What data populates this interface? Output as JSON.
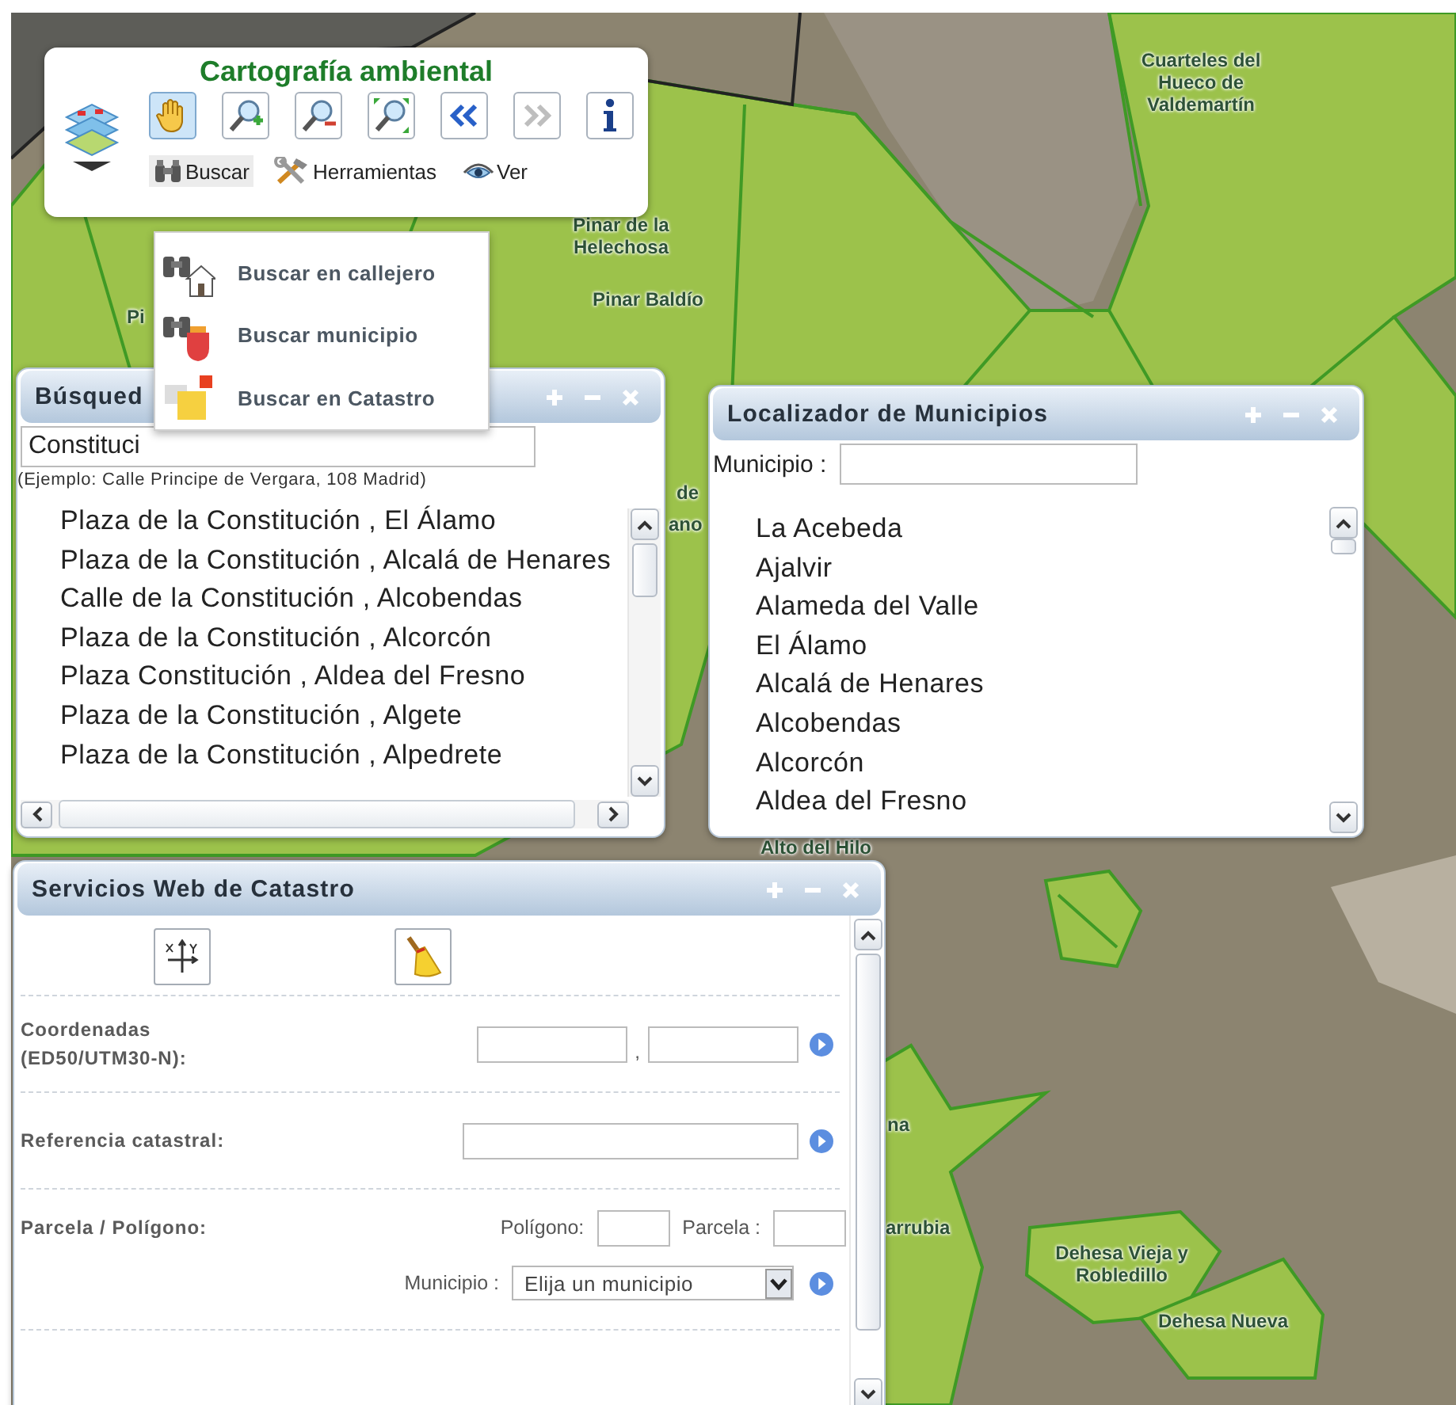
{
  "map": {
    "labels": [
      {
        "text": "Cuarteles del Hueco de Valdemartín"
      },
      {
        "text": "Pinar de la Helechosa"
      },
      {
        "text": "Pinar Baldío"
      },
      {
        "text": "Pi"
      },
      {
        "text": "de"
      },
      {
        "text": "ano"
      },
      {
        "text": "Alto del Hilo"
      },
      {
        "text": "na"
      },
      {
        "text": "arrubia"
      },
      {
        "text": "Dehesa Vieja y Robledillo"
      },
      {
        "text": "Dehesa Nueva"
      }
    ]
  },
  "toolbar": {
    "title": "Cartografía ambiental",
    "tools": [
      {
        "kind": "pan",
        "selected": true,
        "disabled": false
      },
      {
        "kind": "zoom-in",
        "selected": false,
        "disabled": false
      },
      {
        "kind": "zoom-out",
        "selected": false,
        "disabled": false
      },
      {
        "kind": "full-extent",
        "selected": false,
        "disabled": false
      },
      {
        "kind": "back",
        "selected": false,
        "disabled": false
      },
      {
        "kind": "forward",
        "selected": false,
        "disabled": true
      },
      {
        "kind": "info",
        "selected": false,
        "disabled": false
      }
    ],
    "menus": [
      {
        "label": "Buscar",
        "selected": true
      },
      {
        "label": "Herramientas",
        "selected": false
      },
      {
        "label": "Ver",
        "selected": false
      }
    ]
  },
  "dropdown": {
    "items": [
      {
        "label": "Buscar en callejero"
      },
      {
        "label": "Buscar municipio"
      },
      {
        "label": "Buscar en Catastro"
      }
    ]
  },
  "search_window": {
    "title": "Búsqued",
    "query": "Constituci",
    "hint": "(Ejemplo: Calle Principe de Vergara, 108 Madrid)",
    "results": [
      "Plaza de la Constitución , El Álamo",
      "Plaza de la Constitución , Alcalá de Henares",
      "Calle de la Constitución , Alcobendas",
      "Plaza de la Constitución , Alcorcón",
      "Plaza Constitución , Aldea del Fresno",
      "Plaza de la Constitución , Algete",
      "Plaza de la Constitución , Alpedrete"
    ]
  },
  "municipality_window": {
    "title": "Localizador de Municipios",
    "field_label": "Municipio :",
    "items": [
      "La Acebeda",
      "Ajalvir",
      "Alameda del Valle",
      "El Álamo",
      "Alcalá de Henares",
      "Alcobendas",
      "Alcorcón",
      "Aldea del Fresno"
    ]
  },
  "cadastre_window": {
    "title": "Servicios Web de Catastro",
    "coordinates_label": "Coordenadas (ED50/UTM30-N):",
    "coordinates_separator": ",",
    "reference_label": "Referencia catastral:",
    "parcel_label": "Parcela / Polígono:",
    "polygon_label": "Polígono:",
    "plot_label": "Parcela :",
    "municipality_label": "Municipio :",
    "municipality_select": "Elija un municipio"
  }
}
